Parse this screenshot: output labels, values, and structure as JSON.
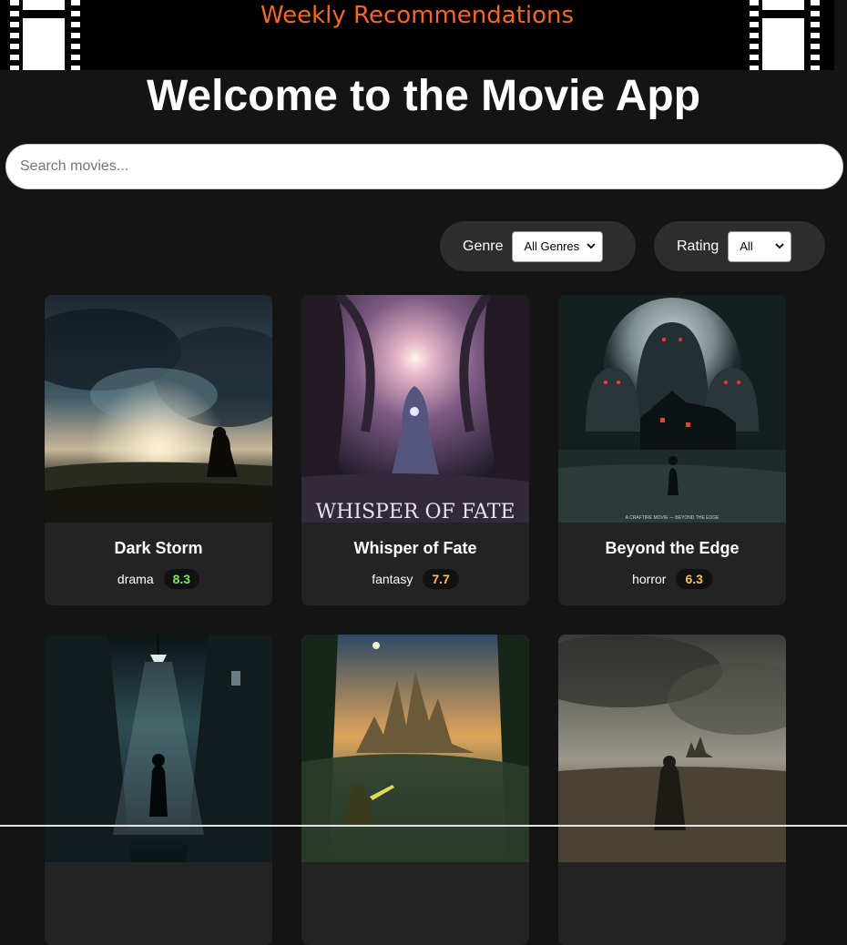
{
  "banner": {
    "title": "Weekly Recommendations"
  },
  "page": {
    "title": "Welcome to the Movie App"
  },
  "search": {
    "placeholder": "Search movies..."
  },
  "filters": {
    "genre": {
      "label": "Genre",
      "selected": "All Genres"
    },
    "rating": {
      "label": "Rating",
      "selected": "All"
    }
  },
  "colors": {
    "accent": "#f2682a",
    "rating_high": "#7bea5a",
    "rating_mid": "#f6c15a",
    "background": "#141414",
    "card": "#232323"
  },
  "movies": [
    {
      "title": "Dark Storm",
      "genre": "drama",
      "rating": "8.3"
    },
    {
      "title": "Whisper of Fate",
      "genre": "fantasy",
      "rating": "7.7",
      "poster_text": "WHISPER OF FATE"
    },
    {
      "title": "Beyond the Edge",
      "genre": "horror",
      "rating": "6.3",
      "poster_text": "A CRAFTIRE MOVIE — BEYOND THE EDGE"
    },
    {
      "title": "",
      "genre": "",
      "rating": ""
    },
    {
      "title": "",
      "genre": "",
      "rating": ""
    },
    {
      "title": "",
      "genre": "",
      "rating": ""
    }
  ]
}
